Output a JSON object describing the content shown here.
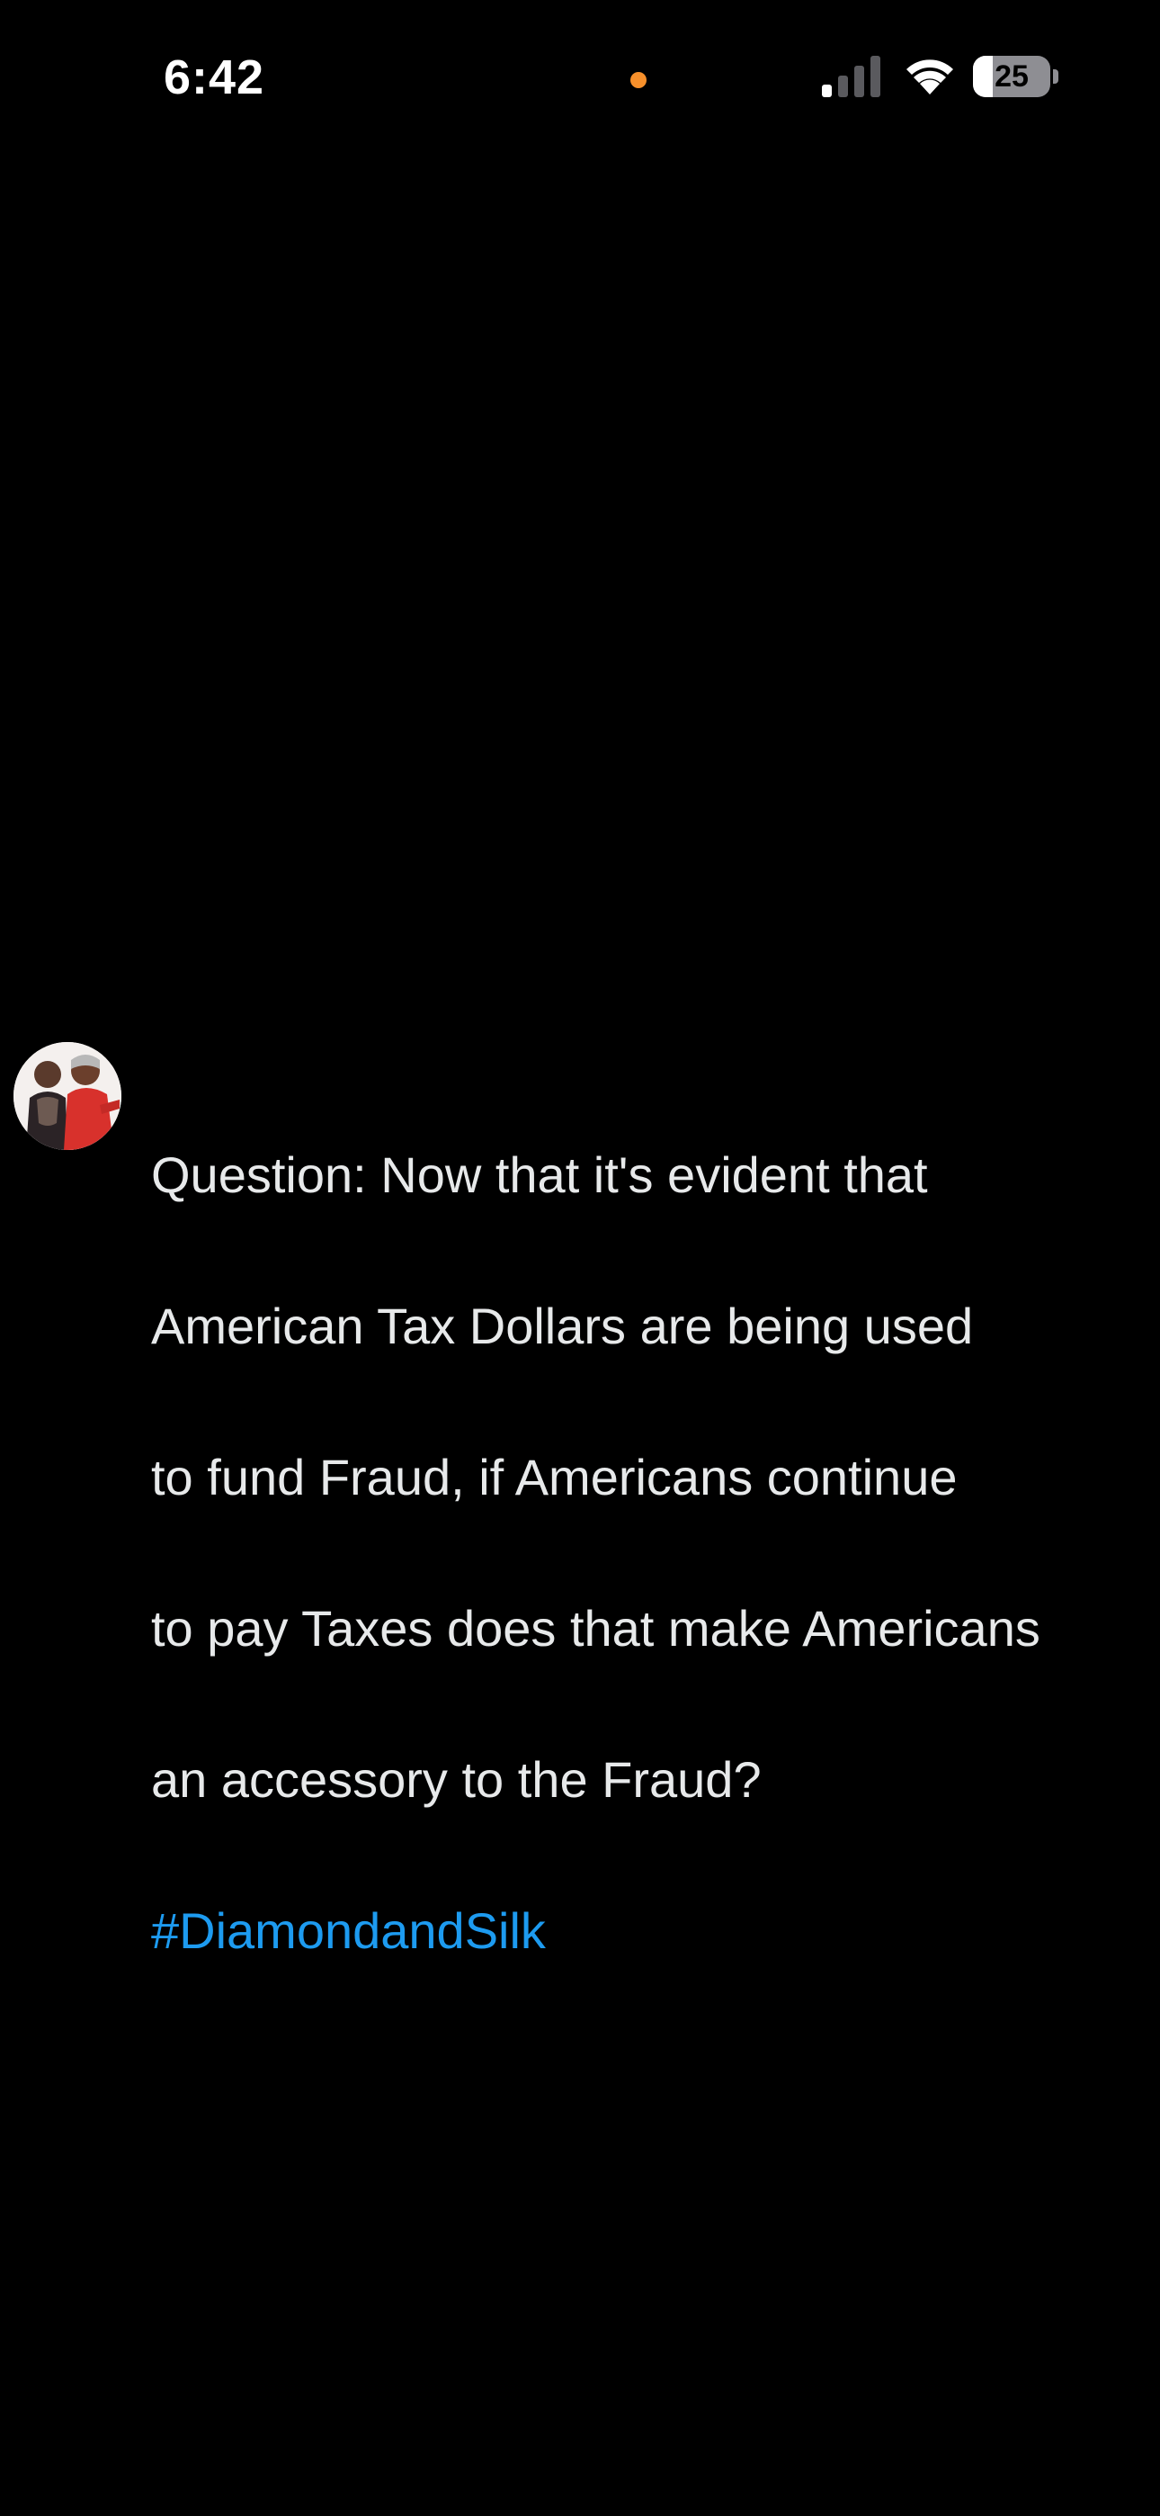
{
  "status_bar": {
    "time": "6:42",
    "privacy_indicator_color": "#f7902b",
    "signal_icon": "cellular-signal-icon",
    "signal_bars_active": 1,
    "signal_bars_total": 4,
    "wifi_icon": "wifi-icon",
    "battery_level": "25",
    "battery_fraction": 0.25
  },
  "post": {
    "avatar_icon": "profile-avatar",
    "lines": [
      "Question:  Now that it's evident that",
      "American Tax Dollars are being used",
      "to fund Fraud, if Americans continue",
      "to pay Taxes does that make Americans",
      "an accessory to the Fraud?"
    ],
    "hashtag": "#DiamondandSilk",
    "hashtag_color": "#1d9bf0"
  }
}
